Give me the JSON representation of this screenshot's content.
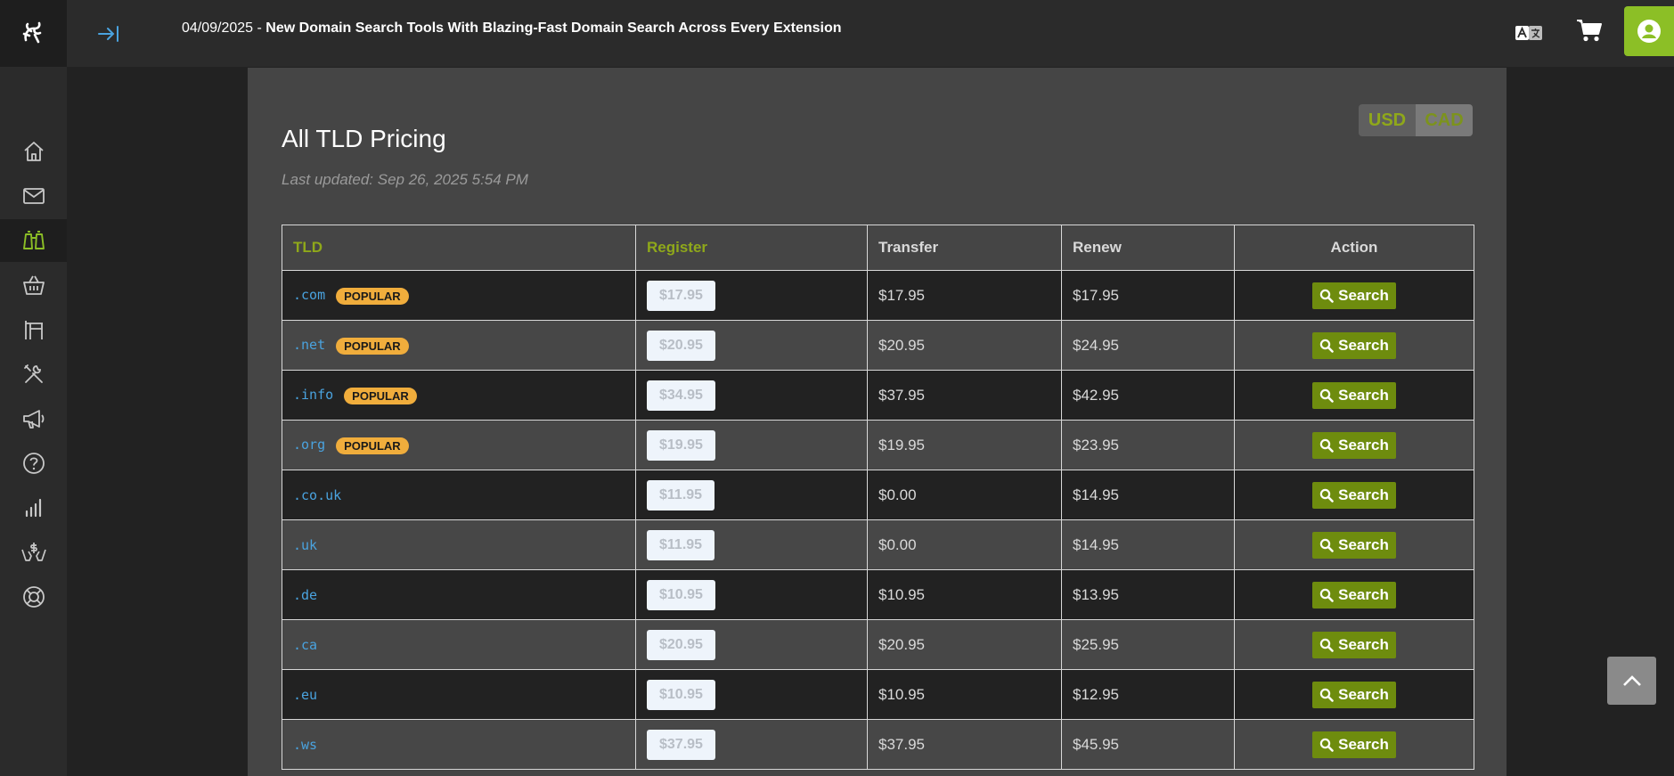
{
  "header": {
    "announcement_date": "04/09/2025 - ",
    "announcement_text": "New Domain Search Tools With Blazing-Fast Domain Search Across Every Extension",
    "accent_color": "#8cbf26"
  },
  "sidebar": {
    "items": [
      {
        "icon": "home-icon"
      },
      {
        "icon": "mail-icon"
      },
      {
        "icon": "binoculars-icon",
        "active": true
      },
      {
        "icon": "basket-icon"
      },
      {
        "icon": "sign-icon"
      },
      {
        "icon": "tools-icon"
      },
      {
        "icon": "megaphone-icon"
      },
      {
        "icon": "help-icon"
      },
      {
        "icon": "stats-icon"
      },
      {
        "icon": "hands-dollar-icon"
      },
      {
        "icon": "lifebuoy-icon"
      }
    ]
  },
  "page": {
    "title": "All TLD Pricing",
    "updated": "Last updated: Sep 26, 2025 5:54 PM",
    "currency": {
      "usd": "USD",
      "cad": "CAD"
    }
  },
  "table": {
    "headers": {
      "tld": "TLD",
      "register": "Register",
      "transfer": "Transfer",
      "renew": "Renew",
      "action": "Action"
    },
    "search_label": "Search",
    "rows": [
      {
        "tld": ".com",
        "badge": "POPULAR",
        "register": "$17.95",
        "transfer": "$17.95",
        "renew": "$17.95"
      },
      {
        "tld": ".net",
        "badge": "POPULAR",
        "register": "$20.95",
        "transfer": "$20.95",
        "renew": "$24.95"
      },
      {
        "tld": ".info",
        "badge": "POPULAR",
        "register": "$34.95",
        "transfer": "$37.95",
        "renew": "$42.95"
      },
      {
        "tld": ".org",
        "badge": "POPULAR",
        "register": "$19.95",
        "transfer": "$19.95",
        "renew": "$23.95"
      },
      {
        "tld": ".co.uk",
        "badge": "",
        "register": "$11.95",
        "transfer": "$0.00",
        "renew": "$14.95"
      },
      {
        "tld": ".uk",
        "badge": "",
        "register": "$11.95",
        "transfer": "$0.00",
        "renew": "$14.95"
      },
      {
        "tld": ".de",
        "badge": "",
        "register": "$10.95",
        "transfer": "$10.95",
        "renew": "$13.95"
      },
      {
        "tld": ".ca",
        "badge": "",
        "register": "$20.95",
        "transfer": "$20.95",
        "renew": "$25.95"
      },
      {
        "tld": ".eu",
        "badge": "",
        "register": "$10.95",
        "transfer": "$10.95",
        "renew": "$12.95"
      },
      {
        "tld": ".ws",
        "badge": "",
        "register": "$37.95",
        "transfer": "$37.95",
        "renew": "$45.95"
      }
    ]
  }
}
